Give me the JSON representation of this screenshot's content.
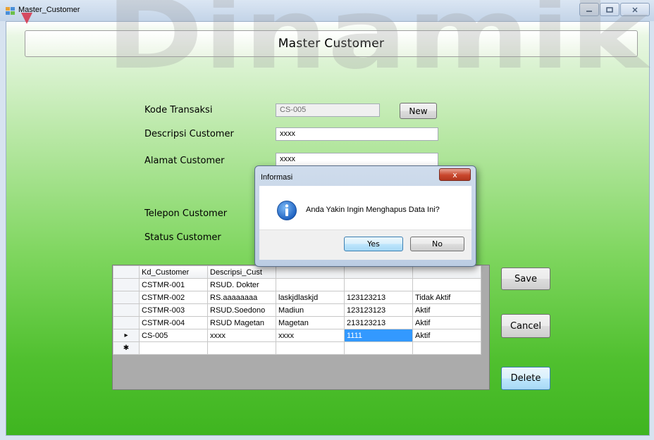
{
  "window": {
    "title": "Master_Customer",
    "watermark": "Dinamik"
  },
  "form": {
    "header": "Master Customer",
    "labels": {
      "kode": "Kode Transaksi",
      "deskripsi": "Descripsi Customer",
      "alamat": "Alamat Customer",
      "telepon": "Telepon Customer",
      "status": "Status Customer"
    },
    "fields": {
      "kode": "CS-005",
      "deskripsi": "xxxx",
      "alamat": "xxxx"
    },
    "buttons": {
      "new": "New",
      "save": "Save",
      "cancel": "Cancel",
      "delete": "Delete"
    }
  },
  "grid": {
    "columns": [
      "Kd_Customer",
      "Descripsi_Cust"
    ],
    "rows": [
      [
        "CSTMR-001",
        "RSUD. Dokter",
        "",
        "",
        ""
      ],
      [
        "CSTMR-002",
        "RS.aaaaaaaa",
        "laskjdlaskjd",
        "123123213",
        "Tidak Aktif"
      ],
      [
        "CSTMR-003",
        "RSUD.Soedono",
        "Madiun",
        "123123123",
        "Aktif"
      ],
      [
        "CSTMR-004",
        "RSUD Magetan",
        "Magetan",
        "213123213",
        "Aktif"
      ],
      [
        "CS-005",
        "xxxx",
        "xxxx",
        "1111",
        "Aktif"
      ]
    ],
    "current_row_marker": "▸",
    "new_row_marker": "✱"
  },
  "dialog": {
    "title": "Informasi",
    "message": "Anda Yakin Ingin Menghapus Data Ini?",
    "yes": "Yes",
    "no": "No",
    "close": "x"
  },
  "colors": {
    "accent": "#3399ff",
    "form_green": "#50c02f",
    "dialog_close": "#c9462c"
  }
}
